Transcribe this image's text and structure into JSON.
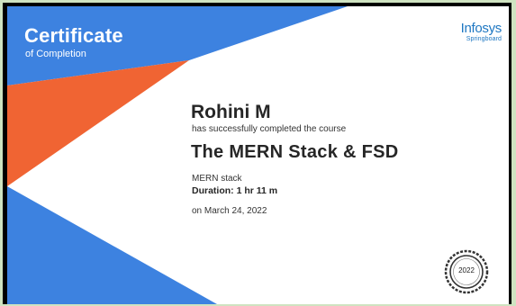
{
  "certificate": {
    "title": "Certificate",
    "subtitle": "of Completion",
    "logo_main": "Infosys",
    "logo_sub": "Springboard",
    "recipient": "Rohini M",
    "completed_text": "has successfully completed the course",
    "course_name": "The MERN Stack & FSD",
    "topic": "MERN stack",
    "duration": "Duration: 1 hr 11 m",
    "date": "on March 24, 2022",
    "badge_year": "2022"
  },
  "colors": {
    "blue": "#3d82e0",
    "orange": "#f06433",
    "dark_blue": "#2a6fd0",
    "frame_green": "#cfe3c1",
    "logo_blue": "#1e77c2"
  }
}
